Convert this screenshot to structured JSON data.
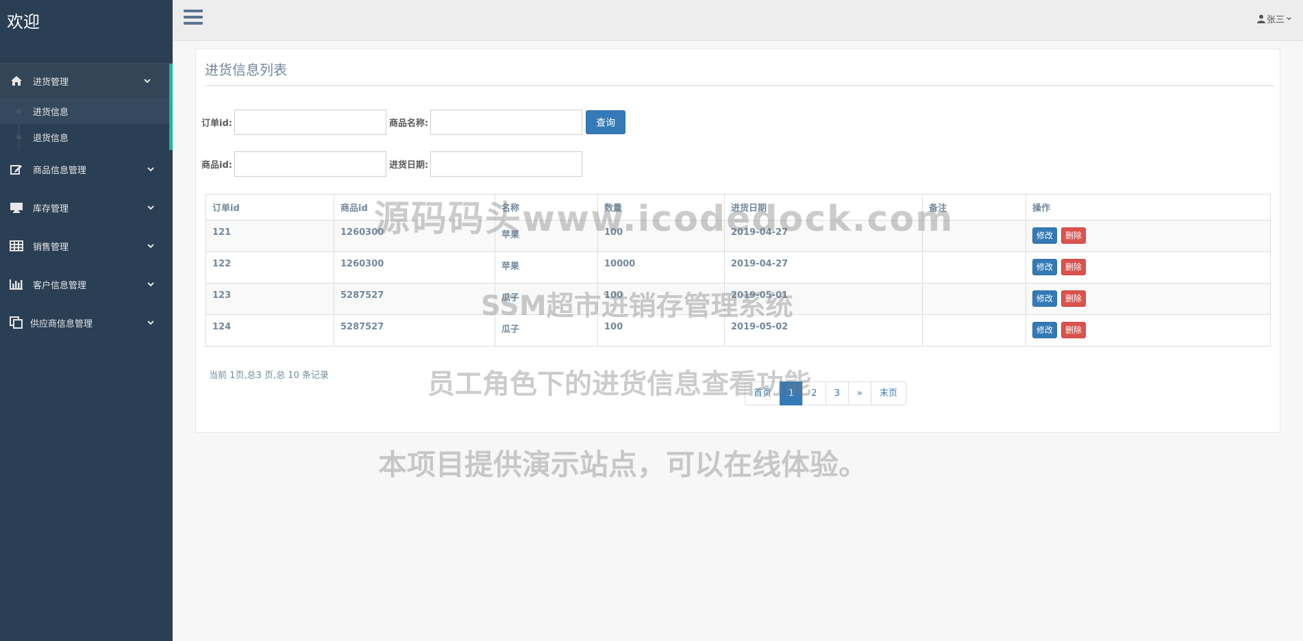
{
  "brand": "欢迎",
  "sidebar": {
    "menu": [
      {
        "label": "进货管理",
        "icon": "home-icon"
      },
      {
        "label": "商品信息管理",
        "icon": "edit-icon"
      },
      {
        "label": "库存管理",
        "icon": "desktop-icon"
      },
      {
        "label": "销售管理",
        "icon": "table-icon"
      },
      {
        "label": "客户信息管理",
        "icon": "bar-chart-icon"
      },
      {
        "label": "供应商信息管理",
        "icon": "clone-icon"
      }
    ],
    "submenu": [
      {
        "label": "进货信息"
      },
      {
        "label": "退货信息"
      }
    ]
  },
  "topbar": {
    "user": "张三"
  },
  "panel": {
    "title": "进货信息列表"
  },
  "form": {
    "order_id_label": "订单id:",
    "product_name_label": "商品名称:",
    "query_button": "查询",
    "product_id_label": "商品id:",
    "date_label": "进货日期:"
  },
  "table": {
    "headers": [
      "订单id",
      "商品id",
      "名称",
      "数量",
      "进货日期",
      "备注",
      "操作"
    ],
    "rows": [
      [
        "121",
        "1260300",
        "苹果",
        "100",
        "2019-04-27",
        ""
      ],
      [
        "122",
        "1260300",
        "苹果",
        "10000",
        "2019-04-27",
        ""
      ],
      [
        "123",
        "5287527",
        "瓜子",
        "100",
        "2019-05-01",
        ""
      ],
      [
        "124",
        "5287527",
        "瓜子",
        "100",
        "2019-05-02",
        ""
      ]
    ],
    "edit_label": "修改",
    "delete_label": "删除"
  },
  "pagination": {
    "summary": "当前 1页,总3 页,总 10 条记录",
    "first": "首页",
    "pages": [
      "1",
      "2",
      "3"
    ],
    "next": "»",
    "last": "末页"
  },
  "watermarks": {
    "line1": "源码码头www.icodedock.com",
    "line2": "SSM超市进销存管理系统",
    "line3": "员工角色下的进货信息查看功能",
    "line4": "本项目提供演示站点，可以在线体验。"
  },
  "colors": {
    "sidebar_bg": "#2a3f54",
    "accent": "#1abb9c",
    "primary": "#337ab7",
    "danger": "#d9534f"
  }
}
